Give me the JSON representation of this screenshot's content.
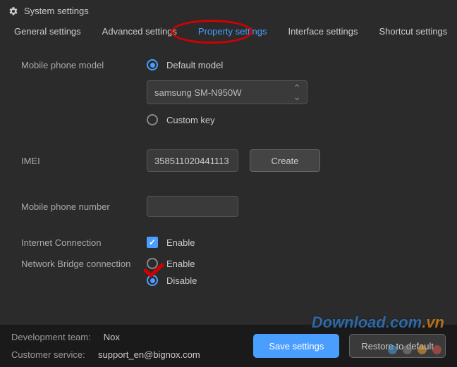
{
  "header": {
    "title": "System settings"
  },
  "tabs": {
    "general": "General settings",
    "advanced": "Advanced settings",
    "property": "Property settings",
    "interface": "Interface settings",
    "shortcut": "Shortcut settings"
  },
  "form": {
    "mobileModel": {
      "label": "Mobile phone model",
      "defaultOption": "Default model",
      "selected": "samsung SM-N950W",
      "customOption": "Custom key"
    },
    "imei": {
      "label": "IMEI",
      "value": "358511020441113",
      "createBtn": "Create"
    },
    "phoneNumber": {
      "label": "Mobile phone number",
      "value": ""
    },
    "internet": {
      "label": "Internet Connection",
      "enable": "Enable"
    },
    "bridge": {
      "label": "Network Bridge connection",
      "enable": "Enable",
      "disable": "Disable"
    }
  },
  "footer": {
    "devTeamLabel": "Development team:",
    "devTeamValue": "Nox",
    "supportLabel": "Customer service:",
    "supportValue": "support_en@bignox.com",
    "saveBtn": "Save settings",
    "restoreBtn": "Restore to default"
  },
  "watermark": {
    "main": "Download",
    "suffix": ".com",
    "vn": ".vn"
  }
}
